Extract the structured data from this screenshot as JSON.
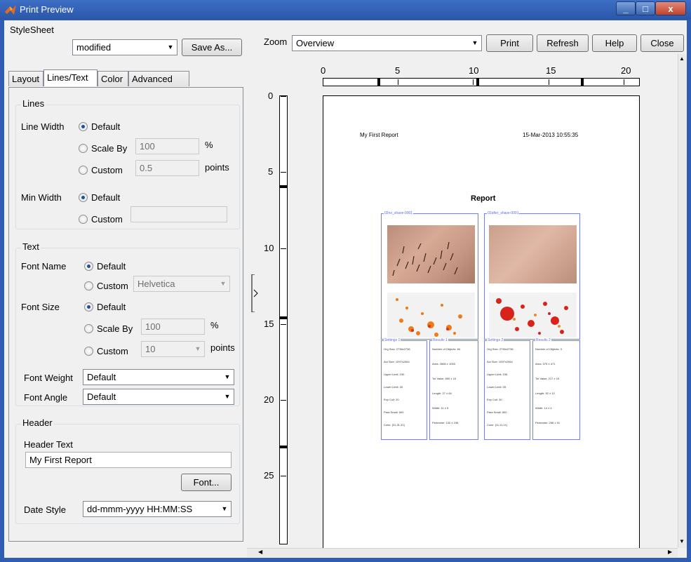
{
  "window": {
    "title": "Print Preview",
    "min": "_",
    "max": "□",
    "close": "x"
  },
  "stylesheet": {
    "label": "StyleSheet",
    "value": "modified",
    "save_as": "Save As..."
  },
  "tabs": [
    "Layout",
    "Lines/Text",
    "Color",
    "Advanced"
  ],
  "lines": {
    "legend": "Lines",
    "line_width_label": "Line Width",
    "default_label": "Default",
    "scale_by_label": "Scale By",
    "scale_by_value": "100",
    "percent": "%",
    "custom_label": "Custom",
    "custom_value": "0.5",
    "points": "points",
    "min_width_label": "Min Width",
    "min_default_label": "Default",
    "min_custom_label": "Custom",
    "min_custom_value": ""
  },
  "text": {
    "legend": "Text",
    "font_name_label": "Font Name",
    "default_label": "Default",
    "custom_label": "Custom",
    "font_name_value": "Helvetica",
    "font_size_label": "Font Size",
    "size_default_label": "Default",
    "scale_by_label": "Scale By",
    "scale_by_value": "100",
    "percent": "%",
    "size_custom_label": "Custom",
    "size_custom_value": "10",
    "points": "points",
    "font_weight_label": "Font Weight",
    "font_weight_value": "Default",
    "font_angle_label": "Font Angle",
    "font_angle_value": "Default"
  },
  "header": {
    "legend": "Header",
    "header_text_label": "Header Text",
    "header_text_value": "My First Report",
    "font_button": "Font...",
    "date_style_label": "Date Style",
    "date_style_value": "dd-mmm-yyyy HH:MM:SS"
  },
  "toolbar": {
    "zoom_label": "Zoom",
    "zoom_value": "Overview",
    "print": "Print",
    "refresh": "Refresh",
    "help": "Help",
    "close": "Close"
  },
  "ruler": {
    "h_ticks": [
      "0",
      "5",
      "10",
      "15",
      "20"
    ],
    "v_ticks": [
      "0",
      "5",
      "10",
      "15",
      "20",
      "25"
    ]
  },
  "report": {
    "header_left": "My First Report",
    "header_right": "15-Mar-2013 10:55:35",
    "title": "Report",
    "panel1_title": "02no_shave-0001",
    "panel2_title": "02after_shave-0001",
    "settings1": "Settings 1",
    "results1": "Results 1",
    "settings2": "Settings 2",
    "results2": "Results 2",
    "settings1_lines": [
      "Org Size: 2736x2736",
      "Act Size: 1097x2064",
      "Upper Limit: 150",
      "Lower Limit: 30",
      "Exp Coll: 20",
      "Para Small: 500",
      "Color: [31,31,31]"
    ],
    "results1_lines": [
      "Number of Objects: 84",
      "Area: 2808 ± 1053",
      "Tot Value: 690 ± 10",
      "Length: 27 ± 64",
      "Width: 11 ± 5",
      "Perimeter: 100 ± 238"
    ],
    "settings2_lines": [
      "Org Size: 2736x2736",
      "Act Size: 1097x2064",
      "Upper Limit: 155",
      "Lower Limit: 05",
      "Exp Coll: 30",
      "Para Small: 500",
      "Color: [11,11,11]"
    ],
    "results2_lines": [
      "Number of Objects: 3",
      "Area: 375 ± 471",
      "Tot Value: 217 ± 19",
      "Length: 52 ± 12",
      "Width: 14 ± 4",
      "Perimeter: 256 ± 91"
    ]
  }
}
